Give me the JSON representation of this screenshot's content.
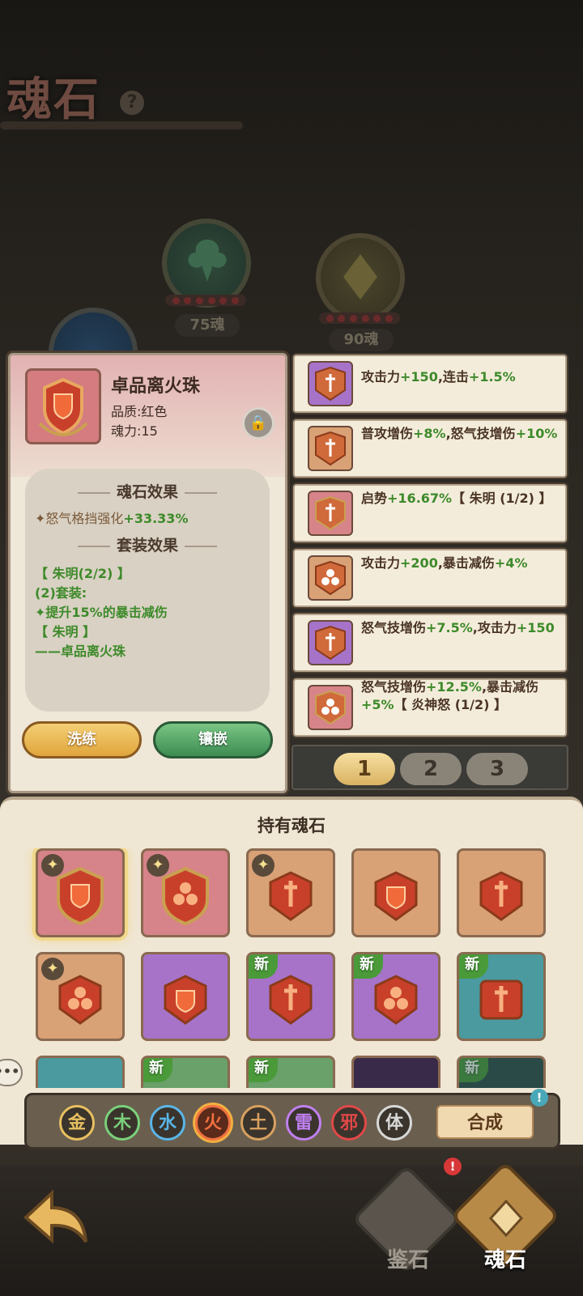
{
  "page_title": "魂石",
  "help_label": "?",
  "bg_slots": [
    {
      "label": "75魂"
    },
    {
      "label": "90魂"
    }
  ],
  "detail": {
    "name": "卓品离火珠",
    "quality": "品质:红色",
    "power": "魂力:15",
    "lock_icon": "lock-icon",
    "stone_effect_title": "魂石效果",
    "stone_effect_prefix": "✦怒气格挡强化",
    "stone_effect_value": "+33.33%",
    "set_effect_title": "套装效果",
    "set_lines": [
      "【 朱明(2/2) 】",
      "(2)套装:",
      "✦提升15%的暴击减伤",
      "【 朱明 】",
      "——卓品离火珠"
    ],
    "refine_label": "洗练",
    "inlay_label": "镶嵌"
  },
  "list_items": [
    {
      "text_a": "攻击力",
      "val_a": "+150",
      "text_b": ",连击",
      "val_b": "+1.5%",
      "text_c": "",
      "val_c": "",
      "text_d": "",
      "color": "purple"
    },
    {
      "text_a": "普攻增伤",
      "val_a": "+8%",
      "text_b": ",怒气技增伤",
      "val_b": "+10%",
      "text_c": "",
      "val_c": "",
      "text_d": "",
      "color": "orange"
    },
    {
      "text_a": "启势",
      "val_a": "+16.67%",
      "text_b": "【 朱明 (1/2) 】",
      "val_b": "",
      "text_c": "",
      "val_c": "",
      "text_d": "",
      "color": "pink"
    },
    {
      "text_a": "攻击力",
      "val_a": "+200",
      "text_b": ",暴击减伤",
      "val_b": "+4%",
      "text_c": "",
      "val_c": "",
      "text_d": "",
      "color": "orange"
    },
    {
      "text_a": "怒气技增伤",
      "val_a": "+7.5%",
      "text_b": ",攻击力",
      "val_b": "+150",
      "text_c": "",
      "val_c": "",
      "text_d": "",
      "color": "purple"
    },
    {
      "text_a": "怒气技增伤",
      "val_a": "+12.5%",
      "text_b": ",暴击减伤",
      "val_b": "+5%",
      "text_c": "【 炎神怒 (1/2) 】",
      "val_c": "",
      "text_d": "",
      "color": "pink"
    }
  ],
  "pages": [
    "1",
    "2",
    "3"
  ],
  "inventory": {
    "title": "持有魂石",
    "new_badge": "新",
    "star_badge": "✦"
  },
  "elements": [
    {
      "label": "金",
      "color": "#e8c060"
    },
    {
      "label": "木",
      "color": "#7ad07a"
    },
    {
      "label": "水",
      "color": "#5ab6e8"
    },
    {
      "label": "火",
      "color": "#f07040"
    },
    {
      "label": "土",
      "color": "#d8a060"
    },
    {
      "label": "雷",
      "color": "#c080f0"
    },
    {
      "label": "邪",
      "color": "#e04848"
    },
    {
      "label": "体",
      "color": "#d8d8d8"
    }
  ],
  "merge_label": "合成",
  "alert_mark": "!",
  "nav": {
    "jianshi": "鉴石",
    "hunshi": "魂石"
  },
  "chat_bubble": "•••"
}
